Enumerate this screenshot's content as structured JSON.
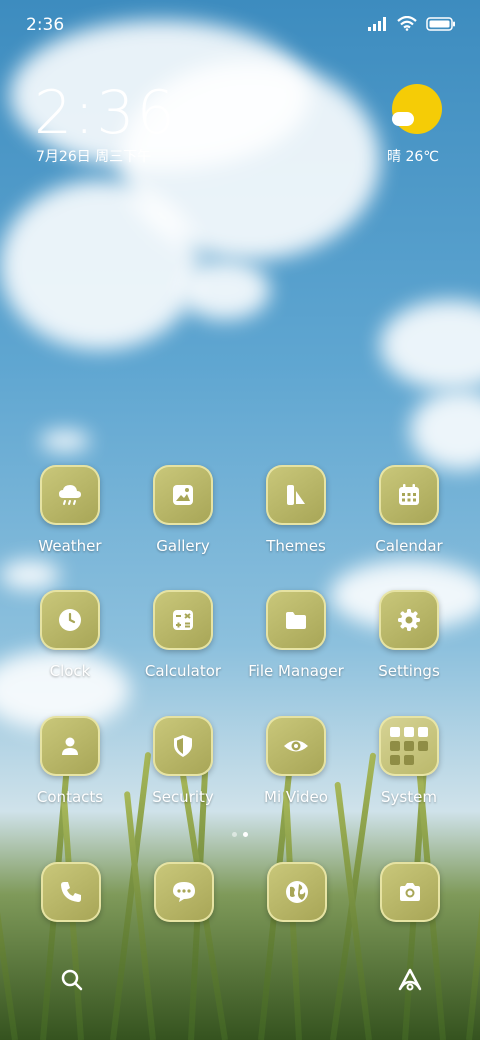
{
  "status_bar": {
    "time": "2:36",
    "signal": "signal-icon",
    "wifi": "wifi-icon",
    "battery": "battery-icon"
  },
  "clock_widget": {
    "time": "2:36",
    "date": "7月26日 周三下午"
  },
  "weather_widget": {
    "condition_icon": "sunny-partly-cloudy-icon",
    "text": "晴 26℃"
  },
  "apps": [
    {
      "label": "Weather",
      "icon": "weather-icon"
    },
    {
      "label": "Gallery",
      "icon": "gallery-icon"
    },
    {
      "label": "Themes",
      "icon": "themes-icon"
    },
    {
      "label": "Calendar",
      "icon": "calendar-icon"
    },
    {
      "label": "Clock",
      "icon": "clock-icon"
    },
    {
      "label": "Calculator",
      "icon": "calculator-icon"
    },
    {
      "label": "File Manager",
      "icon": "folder-icon"
    },
    {
      "label": "Settings",
      "icon": "gear-icon"
    },
    {
      "label": "Contacts",
      "icon": "contacts-icon"
    },
    {
      "label": "Security",
      "icon": "shield-icon"
    },
    {
      "label": "Mi Video",
      "icon": "eye-icon"
    },
    {
      "label": "System",
      "icon": "system-folder-icon"
    }
  ],
  "page_indicator": {
    "pages": 2,
    "current": 2
  },
  "dock": [
    {
      "icon": "phone-icon"
    },
    {
      "icon": "messages-icon"
    },
    {
      "icon": "browser-icon"
    },
    {
      "icon": "camera-icon"
    }
  ],
  "bottom_bar": {
    "left": "search-icon",
    "right": "app-vault-icon"
  },
  "colors": {
    "icon_tile": "#b8b666",
    "icon_border": "#ebe8aa",
    "sun": "#f5cc06"
  }
}
